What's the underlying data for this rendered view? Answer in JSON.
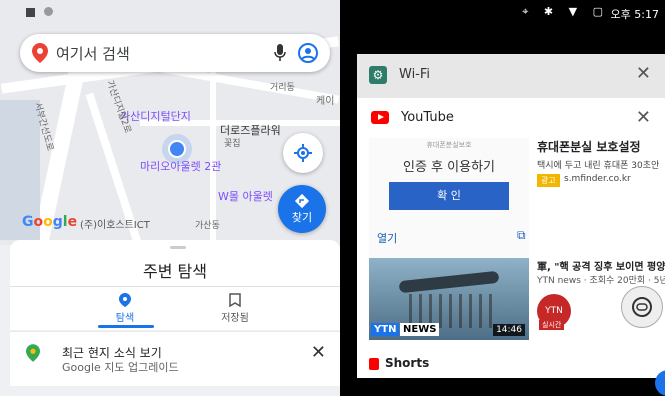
{
  "maps": {
    "search_placeholder": "여기서 검색",
    "pois": [
      "가산디지털단지",
      "더로즈플라워",
      "꽃집",
      "마리오아울렛 2관",
      "W몰 아울렛",
      "(주)이호스트ICT",
      "가산동",
      "거리동",
      "케이",
      "가산디지털2로",
      "서부간선도로"
    ],
    "directions_label": "찾기",
    "google_logo": "Google",
    "sheet_title": "주변 탐색",
    "tabs": [
      {
        "label": "탐색",
        "icon": "pin-icon",
        "active": true
      },
      {
        "label": "저장됨",
        "icon": "bookmark-icon",
        "active": false
      }
    ],
    "news": {
      "title": "최근 현지 소식 보기",
      "subtitle": "Google 지도 업그레이드"
    },
    "accent": "#1a73e8"
  },
  "recents": {
    "status_time": "오후 5:17",
    "wifi_card": {
      "title": "Wi-Fi"
    },
    "youtube_card": {
      "title": "YouTube",
      "ad": {
        "small_header": "휴대폰분실보호",
        "big_text": "인증 후 이용하기",
        "button": "확 인",
        "open_label": "열기",
        "title": "휴대폰분실 보호설정",
        "subtitle": "택시에 두고 내린 휴대폰 30초안",
        "tag": "광고",
        "url": "s.mfinder.co.kr"
      },
      "video": {
        "title": "軍, \"핵 공격 징후 보이면 평양",
        "meta": "YTN news · 조회수 20만회 · 5년",
        "thumb_brand": "YTN",
        "thumb_news": "NEWS",
        "duration": "14:46",
        "avatar_text": "YTN",
        "live_badge": "실시간"
      },
      "shorts_label": "Shorts"
    }
  }
}
